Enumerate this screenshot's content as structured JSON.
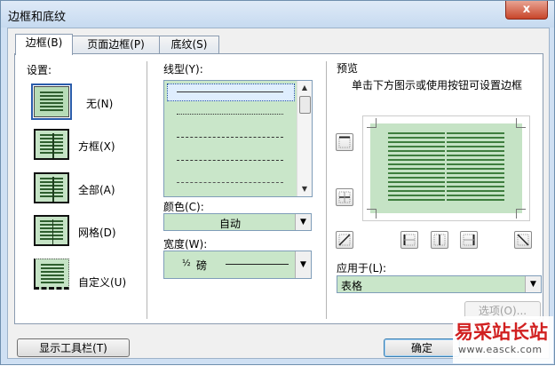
{
  "window": {
    "title": "边框和底纹",
    "close_glyph": "x"
  },
  "tabs": [
    {
      "label": "边框(B)",
      "active": true
    },
    {
      "label": "页面边框(P)",
      "active": false
    },
    {
      "label": "底纹(S)",
      "active": false
    }
  ],
  "settings": {
    "heading": "设置:",
    "options": [
      {
        "label": "无(N)",
        "icon": "border-none-icon",
        "selected": true
      },
      {
        "label": "方框(X)",
        "icon": "border-box-icon",
        "selected": false
      },
      {
        "label": "全部(A)",
        "icon": "border-all-icon",
        "selected": false
      },
      {
        "label": "网格(D)",
        "icon": "border-grid-icon",
        "selected": false
      },
      {
        "label": "自定义(U)",
        "icon": "border-custom-icon",
        "selected": false
      }
    ]
  },
  "line_style": {
    "label": "线型(Y):",
    "options": [
      "solid",
      "dotted",
      "dashed-short",
      "dashed-long",
      "dash-dot"
    ]
  },
  "color": {
    "label": "颜色(C):",
    "value": "自动"
  },
  "width": {
    "label": "宽度(W):",
    "fraction": "½",
    "unit": "磅"
  },
  "preview": {
    "heading": "预览",
    "hint": "单击下方图示或使用按钮可设置边框",
    "buttons": [
      "top-border-icon",
      "inside-horizontal-border-icon",
      "bottom-border-icon",
      "diagonal-down-icon",
      "left-border-icon",
      "inside-vertical-border-icon",
      "right-border-icon",
      "diagonal-up-icon"
    ]
  },
  "apply_to": {
    "label": "应用于(L):",
    "value": "表格"
  },
  "options_button": {
    "label": "选项(O)..."
  },
  "footer": {
    "toolbar_button": "显示工具栏(T)",
    "ok_button": "确定"
  },
  "watermark": {
    "text": "易采站长站",
    "url": "www.easck.com"
  },
  "colors": {
    "panel_green": "#c5e3c5",
    "title_bar": "#cfe0f3",
    "close_red": "#c8452a"
  }
}
